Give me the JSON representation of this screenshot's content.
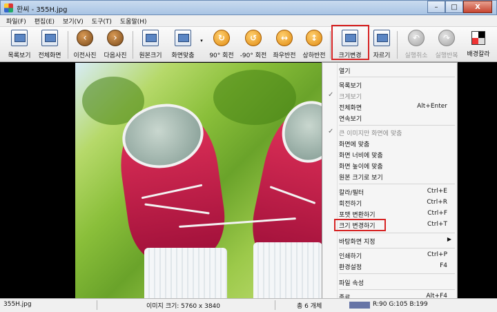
{
  "window": {
    "title": "한씨 - 355H.jpg",
    "buttons": {
      "minimize": "–",
      "maximize": "□",
      "close": "X"
    }
  },
  "menu": [
    "파일(F)",
    "편집(E)",
    "보기(V)",
    "도구(T)",
    "도움말(H)"
  ],
  "toolbar": {
    "buttons": [
      {
        "label": "목록보기",
        "icon": "list-view-icon"
      },
      {
        "label": "전체화면",
        "icon": "fullscreen-icon"
      },
      {
        "label": "이전사진",
        "icon": "previous-icon"
      },
      {
        "label": "다음사진",
        "icon": "next-icon"
      },
      {
        "label": "원본크기",
        "icon": "original-size-icon"
      },
      {
        "label": "화면맞춤",
        "icon": "fit-screen-icon"
      },
      {
        "label": "90° 회전",
        "icon": "rotate-right-icon"
      },
      {
        "label": "-90° 회전",
        "icon": "rotate-left-icon"
      },
      {
        "label": "좌우반전",
        "icon": "flip-horizontal-icon"
      },
      {
        "label": "상하반전",
        "icon": "flip-vertical-icon"
      },
      {
        "label": "크기변경",
        "icon": "resize-icon"
      },
      {
        "label": "자르기",
        "icon": "crop-icon"
      },
      {
        "label": "실행취소",
        "icon": "undo-icon"
      },
      {
        "label": "실행반복",
        "icon": "redo-icon"
      },
      {
        "label": "배경칼라",
        "icon": "background-color-icon"
      }
    ]
  },
  "context_menu": {
    "items": [
      {
        "label": "열기",
        "shortcut": ""
      },
      {
        "label": "목록보기",
        "shortcut": ""
      },
      {
        "label": "크게보기",
        "shortcut": "",
        "checked": true,
        "disabled": true
      },
      {
        "label": "전체화면",
        "shortcut": "Alt+Enter"
      },
      {
        "label": "연속보기",
        "shortcut": ""
      },
      {
        "label": "큰 이미지만 화면에 맞춤",
        "shortcut": "",
        "checked": true,
        "disabled": true
      },
      {
        "label": "화면에 맞춤",
        "shortcut": ""
      },
      {
        "label": "화면 너비에 맞춤",
        "shortcut": ""
      },
      {
        "label": "화면 높이에 맞춤",
        "shortcut": ""
      },
      {
        "label": "원본 크기로 보기",
        "shortcut": ""
      },
      {
        "label": "칼라/필터",
        "shortcut": "Ctrl+E"
      },
      {
        "label": "회전하기",
        "shortcut": "Ctrl+R"
      },
      {
        "label": "포맷 변환하기",
        "shortcut": "Ctrl+F"
      },
      {
        "label": "크기 변경하기",
        "shortcut": "Ctrl+T",
        "highlighted": true
      },
      {
        "label": "바탕화면 지정",
        "shortcut": "",
        "submenu": true
      },
      {
        "label": "인쇄하기",
        "shortcut": "Ctrl+P"
      },
      {
        "label": "환경설정",
        "shortcut": "F4"
      },
      {
        "label": "파일 속성",
        "shortcut": ""
      },
      {
        "label": "종료",
        "shortcut": "Alt+F4"
      }
    ]
  },
  "status": {
    "filename": "355H.jpg",
    "image_size": "이미지 크기: 5760 x 3840",
    "count": "총 6 개체",
    "rgb": "R:90 G:105 B:199"
  },
  "colors": {
    "highlight": "#d62222",
    "accent": "#6674a6"
  }
}
